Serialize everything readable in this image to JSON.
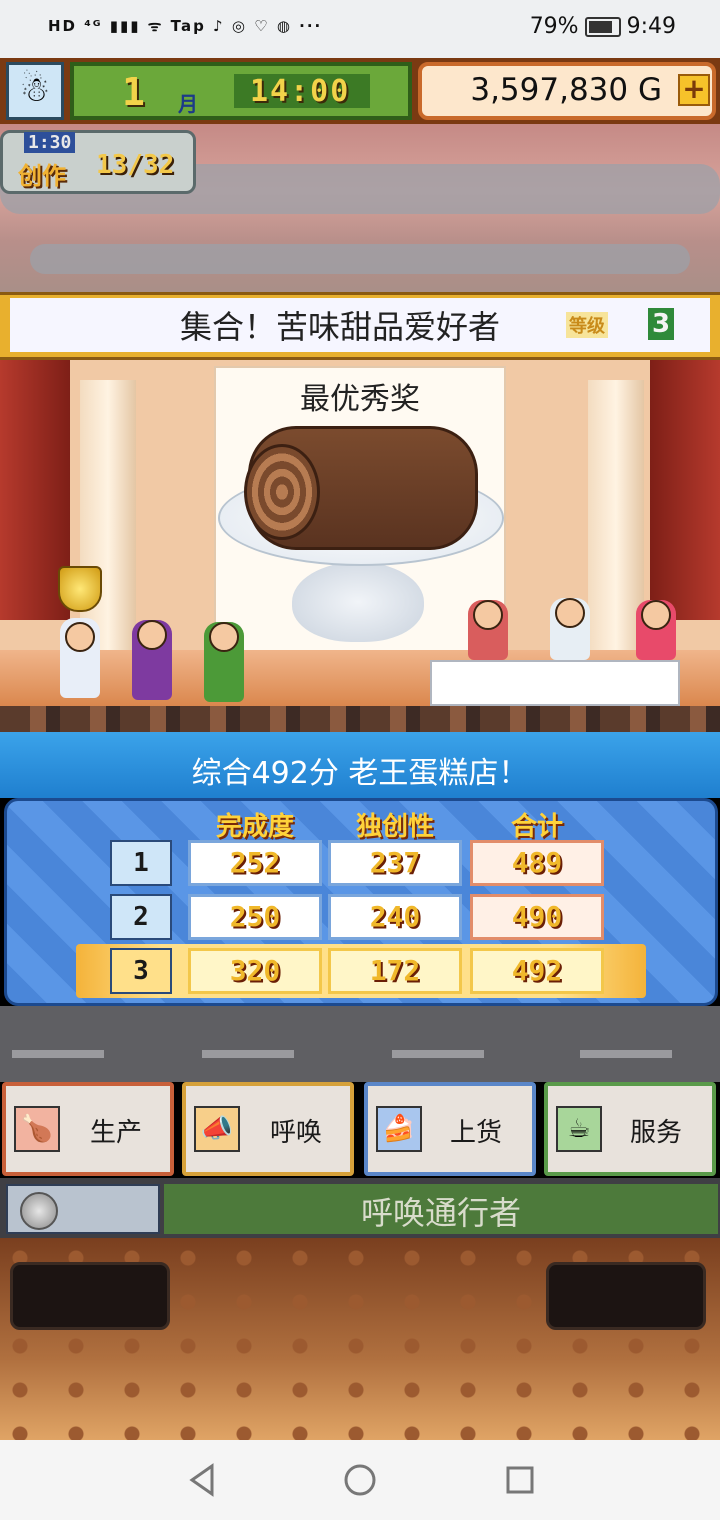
{
  "status_bar": {
    "left_icons": "HD ⁴ᴳ ▮▮▮ ᯤ Tap ♪ ◎ ♡ ◍ ···",
    "battery": "79%",
    "time": "9:49"
  },
  "hud": {
    "month_number": "1",
    "month_unit": "月",
    "game_time": "14:00",
    "money": "3,597,830 G",
    "add_label": "+"
  },
  "challenge": {
    "timer": "1:30",
    "label": "创作",
    "progress": "13/32"
  },
  "contest": {
    "title": "集合！苦味甜品爱好者",
    "rank_label": "等级",
    "rank_value": "3"
  },
  "award": {
    "title": "最优秀奖"
  },
  "result": {
    "summary": "综合492分 老王蛋糕店！",
    "columns": [
      "完成度",
      "独创性",
      "合计"
    ],
    "rows": [
      {
        "rank": "1",
        "completion": "252",
        "originality": "237",
        "total": "489"
      },
      {
        "rank": "2",
        "completion": "250",
        "originality": "240",
        "total": "490"
      },
      {
        "rank": "3",
        "completion": "320",
        "originality": "172",
        "total": "492"
      }
    ],
    "highlight_row": 3
  },
  "actions": [
    {
      "label": "生产",
      "icon": "chicken-icon"
    },
    {
      "label": "呼唤",
      "icon": "megaphone-icon"
    },
    {
      "label": "上货",
      "icon": "cake-slice-icon"
    },
    {
      "label": "服务",
      "icon": "coffee-cup-icon"
    }
  ],
  "summon": {
    "text": "呼唤通行者"
  },
  "colors": {
    "blue_bar": "#1f7fcf",
    "green_hud": "#6ba83a",
    "gold_text": "#f0b82a"
  }
}
